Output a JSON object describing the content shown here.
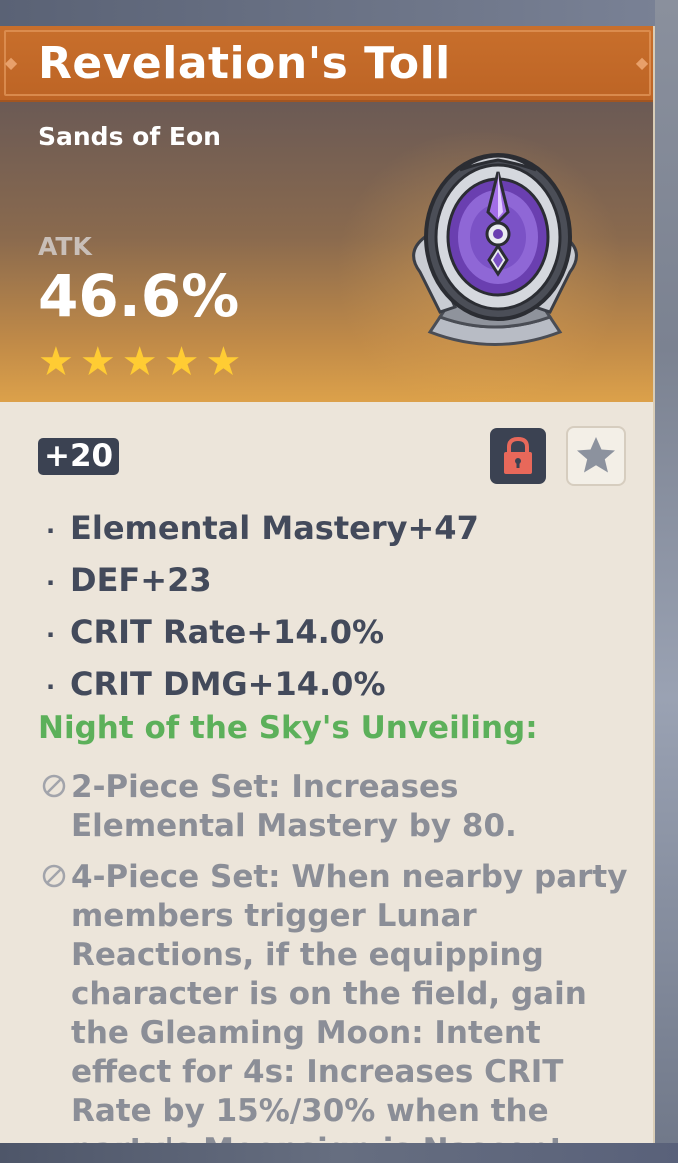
{
  "artifact": {
    "name": "Revelation's Toll",
    "slot": "Sands of Eon",
    "main_stat_label": "ATK",
    "main_stat_value": "46.6%",
    "rarity": 5,
    "level": "+20",
    "locked": true,
    "favorited": false
  },
  "substats": [
    "Elemental Mastery+47",
    "DEF+23",
    "CRIT Rate+14.0%",
    "CRIT DMG+14.0%"
  ],
  "set": {
    "name": "Night of the Sky's Unveiling:",
    "effects": [
      "2-Piece Set: Increases Elemental Mastery by 80.",
      "4-Piece Set: When nearby party members trigger Lunar Reactions, if the equipping character is on the field, gain the Gleaming Moon: Intent effect for 4s: Increases CRIT Rate by 15%/30% when the party's Moonsign is Nascent"
    ]
  },
  "colors": {
    "title_bar": "#c86f2c",
    "star": "#ffcc33",
    "set_name": "#5cb05a",
    "lock_icon": "#e8685a"
  }
}
